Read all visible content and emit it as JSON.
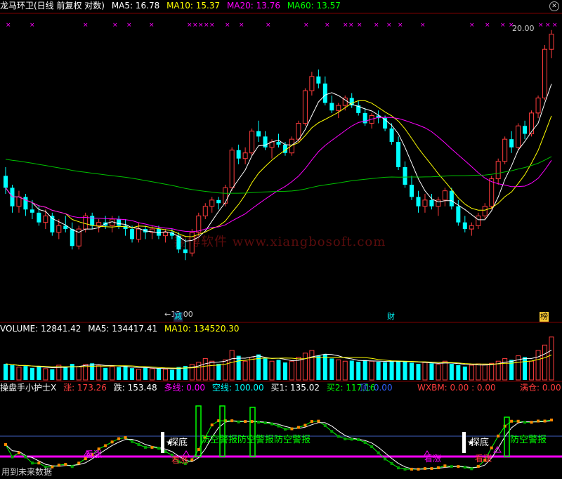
{
  "panels": {
    "price": {
      "header": {
        "stock_name": "龙马环卫(日线 前复权 对数)",
        "ma5": "MA5: 16.78",
        "ma10": "MA10: 15.37",
        "ma20": "MA20: 13.76",
        "ma60": "MA60: 13.57"
      },
      "price_high_label": "20.00",
      "price_low_label": "←12.00",
      "flag_labels": [
        "减",
        "财",
        "榜"
      ],
      "watermark": "翔博软件 www.xiangbosoft.com"
    },
    "volume": {
      "header": {
        "volume": "VOLUME: 12841.42",
        "ma5": "MA5: 134417.41",
        "ma10": "MA10: 134520.30"
      }
    },
    "indicator": {
      "header": {
        "name": "操盘手小护士X",
        "zhang": "涨: 173.26",
        "die": "跌: 153.48",
        "duoxian": "多线: 0.00",
        "kongxian": "空线: 100.00",
        "mai1": "买1: 135.02",
        "mai2": "买2: 117.16",
        "ding": "顶: 0.00",
        "wxbm": "WXBM: 0.00 : 0.00",
        "mancang": "满仓: 0.00"
      },
      "signals": {
        "tandi_1": "探底",
        "tandi_2": "探底",
        "kongtou": "防空警报防空警报防空警报",
        "kongtou_2": "防空警报",
        "kanzhang": "看涨"
      },
      "footer": "用到未来数据"
    }
  },
  "colors": {
    "up": "#ff3c3c",
    "down": "#00ffff",
    "ma5": "#ffffff",
    "ma10": "#ffff00",
    "ma20": "#ff00ff",
    "ma60": "#00c000",
    "grid": "#800000"
  },
  "chart_data": [
    {
      "type": "candlestick",
      "title": "龙马环卫(日线 前复权 对数)",
      "ylim": [
        10.5,
        21.0
      ],
      "y_scale": "log",
      "candles": [
        [
          14.6,
          14.9,
          14.0,
          14.2
        ],
        [
          14.2,
          14.3,
          13.4,
          13.6
        ],
        [
          13.6,
          14.1,
          13.4,
          13.9
        ],
        [
          13.9,
          14.0,
          13.3,
          13.5
        ],
        [
          13.5,
          13.8,
          13.2,
          13.4
        ],
        [
          13.4,
          13.6,
          13.0,
          13.1
        ],
        [
          13.1,
          13.5,
          12.9,
          13.3
        ],
        [
          13.3,
          13.4,
          12.7,
          12.8
        ],
        [
          12.8,
          13.2,
          12.6,
          13.0
        ],
        [
          13.0,
          13.3,
          12.8,
          12.9
        ],
        [
          12.9,
          13.1,
          12.3,
          12.4
        ],
        [
          12.4,
          13.0,
          12.3,
          12.9
        ],
        [
          12.9,
          13.4,
          12.8,
          13.3
        ],
        [
          13.3,
          13.4,
          12.9,
          13.0
        ],
        [
          13.0,
          13.2,
          12.8,
          13.1
        ],
        [
          13.1,
          13.3,
          12.9,
          13.0
        ],
        [
          13.0,
          13.3,
          12.8,
          13.2
        ],
        [
          13.2,
          13.3,
          12.9,
          13.0
        ],
        [
          13.0,
          13.2,
          12.7,
          12.9
        ],
        [
          12.9,
          13.0,
          12.5,
          12.6
        ],
        [
          12.6,
          13.1,
          12.5,
          12.9
        ],
        [
          12.9,
          13.0,
          12.6,
          12.8
        ],
        [
          12.8,
          13.0,
          12.6,
          12.9
        ],
        [
          12.9,
          13.0,
          12.6,
          12.7
        ],
        [
          12.7,
          12.9,
          12.5,
          12.8
        ],
        [
          12.8,
          12.9,
          12.6,
          12.7
        ],
        [
          12.7,
          12.8,
          12.2,
          12.3
        ],
        [
          12.3,
          12.6,
          12.0,
          12.2
        ],
        [
          12.2,
          12.9,
          12.1,
          12.8
        ],
        [
          12.8,
          13.4,
          12.7,
          13.3
        ],
        [
          13.3,
          13.7,
          13.2,
          13.6
        ],
        [
          13.6,
          13.9,
          13.4,
          13.8
        ],
        [
          13.8,
          13.9,
          13.5,
          13.7
        ],
        [
          13.7,
          14.3,
          13.6,
          14.2
        ],
        [
          14.2,
          15.6,
          14.1,
          15.5
        ],
        [
          15.5,
          15.7,
          15.0,
          15.2
        ],
        [
          15.2,
          15.6,
          15.0,
          15.4
        ],
        [
          15.4,
          16.3,
          15.3,
          16.2
        ],
        [
          16.2,
          16.6,
          15.8,
          16.0
        ],
        [
          16.0,
          16.2,
          15.5,
          15.6
        ],
        [
          15.6,
          15.9,
          15.2,
          15.8
        ],
        [
          15.8,
          16.1,
          15.6,
          15.7
        ],
        [
          15.7,
          15.8,
          15.3,
          15.4
        ],
        [
          15.4,
          16.0,
          15.3,
          15.9
        ],
        [
          15.9,
          16.6,
          15.8,
          16.5
        ],
        [
          16.5,
          17.9,
          16.4,
          17.8
        ],
        [
          17.8,
          18.6,
          17.6,
          18.4
        ],
        [
          18.4,
          18.7,
          17.9,
          18.1
        ],
        [
          18.1,
          18.4,
          17.2,
          17.3
        ],
        [
          17.3,
          17.6,
          16.9,
          17.0
        ],
        [
          17.0,
          17.3,
          16.7,
          17.2
        ],
        [
          17.2,
          17.6,
          17.0,
          17.5
        ],
        [
          17.5,
          17.7,
          17.1,
          17.2
        ],
        [
          17.2,
          17.4,
          16.8,
          16.9
        ],
        [
          16.9,
          17.1,
          16.4,
          16.5
        ],
        [
          16.5,
          16.9,
          16.3,
          16.8
        ],
        [
          16.8,
          17.0,
          16.5,
          16.7
        ],
        [
          16.7,
          16.8,
          16.2,
          16.3
        ],
        [
          16.3,
          16.5,
          15.7,
          15.8
        ],
        [
          15.8,
          16.0,
          14.8,
          14.9
        ],
        [
          14.9,
          15.1,
          14.2,
          14.3
        ],
        [
          14.3,
          14.6,
          13.8,
          13.9
        ],
        [
          13.9,
          14.1,
          13.4,
          13.6
        ],
        [
          13.6,
          14.0,
          13.4,
          13.8
        ],
        [
          13.8,
          14.0,
          13.5,
          13.6
        ],
        [
          13.6,
          13.9,
          13.3,
          13.8
        ],
        [
          13.8,
          14.2,
          13.6,
          14.1
        ],
        [
          14.1,
          14.2,
          13.5,
          13.6
        ],
        [
          13.6,
          13.8,
          13.0,
          13.1
        ],
        [
          13.1,
          13.3,
          12.8,
          12.9
        ],
        [
          12.9,
          13.1,
          12.7,
          13.0
        ],
        [
          13.0,
          13.4,
          12.9,
          13.3
        ],
        [
          13.3,
          13.7,
          13.2,
          13.6
        ],
        [
          13.6,
          14.6,
          13.5,
          14.5
        ],
        [
          14.5,
          15.2,
          14.3,
          15.1
        ],
        [
          15.1,
          16.0,
          15.0,
          15.9
        ],
        [
          15.9,
          16.2,
          15.4,
          15.6
        ],
        [
          15.6,
          16.5,
          15.5,
          16.4
        ],
        [
          16.4,
          16.6,
          15.9,
          16.1
        ],
        [
          16.1,
          17.0,
          16.0,
          16.9
        ],
        [
          16.9,
          17.6,
          16.7,
          17.5
        ],
        [
          17.5,
          19.8,
          17.4,
          19.6
        ],
        [
          19.6,
          20.5,
          19.2,
          20.3
        ]
      ]
    },
    {
      "type": "bar",
      "title": "VOLUME",
      "series": [
        {
          "name": "VOLUME",
          "values": [
            60,
            55,
            48,
            52,
            45,
            50,
            42,
            40,
            55,
            48,
            60,
            50,
            58,
            62,
            55,
            45,
            50,
            48,
            52,
            44,
            40,
            46,
            42,
            44,
            40,
            38,
            48,
            52,
            58,
            66,
            80,
            70,
            60,
            75,
            110,
            90,
            70,
            85,
            95,
            80,
            70,
            75,
            65,
            70,
            85,
            100,
            110,
            90,
            95,
            80,
            75,
            70,
            72,
            68,
            74,
            70,
            68,
            66,
            72,
            70,
            68,
            64,
            60,
            65,
            62,
            58,
            70,
            60,
            55,
            50,
            55,
            60,
            58,
            62,
            70,
            80,
            75,
            90,
            85,
            70,
            110,
            130,
            160
          ]
        }
      ]
    }
  ]
}
